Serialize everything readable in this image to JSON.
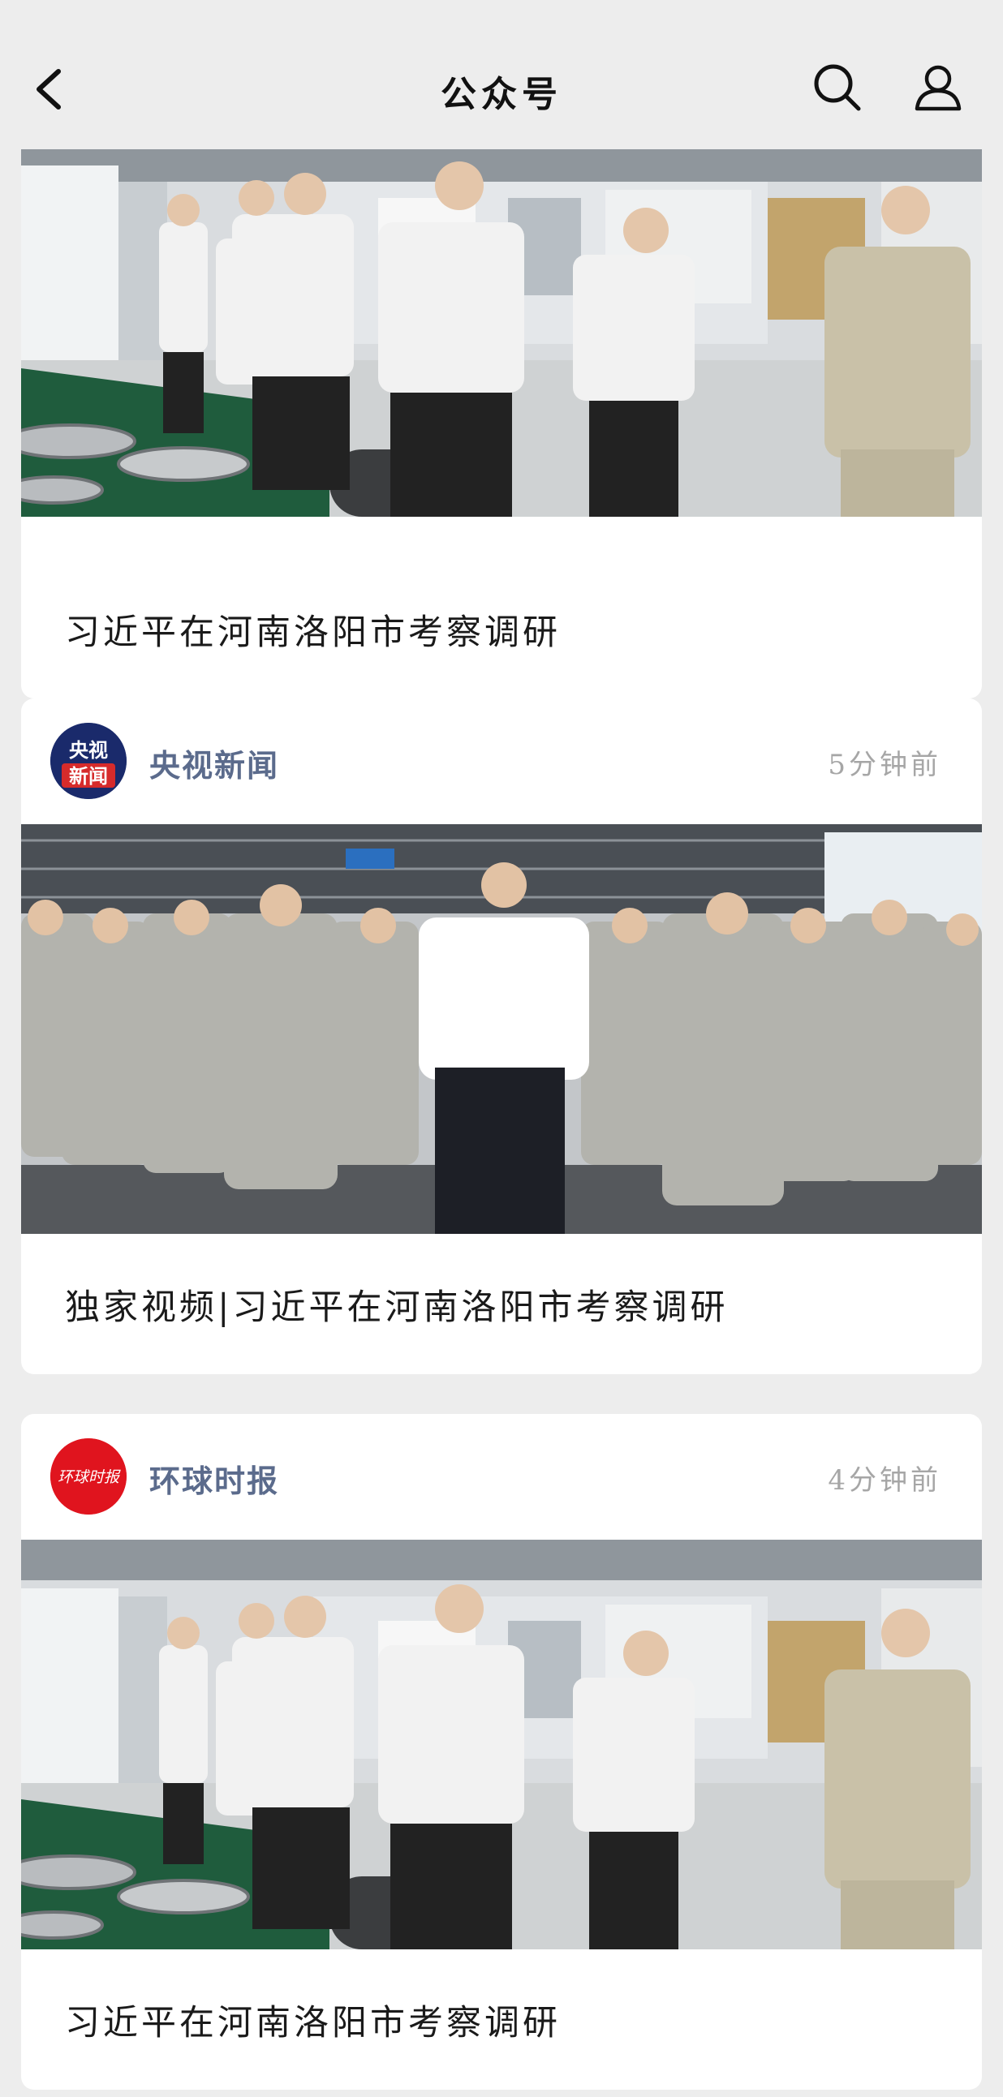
{
  "header": {
    "title": "公众号",
    "back_icon": "chevron-left-icon",
    "search_icon": "search-icon",
    "profile_icon": "user-icon"
  },
  "articles": [
    {
      "headline": "习近平在河南洛阳市考察调研",
      "photo_desc": "factory-visit-photo"
    },
    {
      "source": "央视新闻",
      "avatar_text_top": "央视",
      "avatar_text_bottom": "新闻",
      "time": "5分钟前",
      "headline": "独家视频|习近平在河南洛阳市考察调研",
      "photo_desc": "workers-applauding-photo"
    },
    {
      "source": "环球时报",
      "avatar_text": "环球时报",
      "time": "4分钟前",
      "headline": "习近平在河南洛阳市考察调研",
      "photo_desc": "factory-visit-photo"
    }
  ],
  "colors": {
    "background": "#ededed",
    "card": "#ffffff",
    "source_name": "#5b6b8c",
    "time": "#a6a6a6",
    "cctv_avatar": "#1a2a6b",
    "huanqiu_avatar": "#e0141e"
  }
}
